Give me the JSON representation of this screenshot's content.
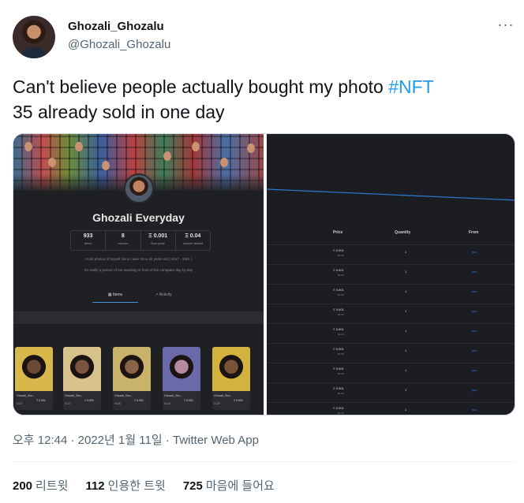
{
  "author": {
    "display_name": "Ghozali_Ghozalu",
    "handle": "@Ghozali_Ghozalu"
  },
  "tweet": {
    "text_before": "Can't believe people actually bought my photo ",
    "hashtag": "#NFT",
    "text_line2": "35 already sold in one day"
  },
  "media": {
    "collection": {
      "name": "Ghozali Everyday",
      "stats": [
        {
          "value": "933",
          "label": "items"
        },
        {
          "value": "8",
          "label": "owners"
        },
        {
          "value": "Ξ 0.001",
          "label": "floor price"
        },
        {
          "value": "Ξ 0.04",
          "label": "volume traded"
        }
      ],
      "description_1": "I took photos of myself since I was 18 to 22 years old ( 2017 - 2021 )",
      "description_2": "It's really a picture of me standing in front of the computer day by day",
      "tabs": {
        "items": "Items",
        "activity": "Activity"
      },
      "cards": [
        {
          "name": "Ghozali_Gho...",
          "num": "#137",
          "price": "Ξ 0.001"
        },
        {
          "name": "Ghozali_Gho...",
          "num": "#137",
          "price": "Ξ 0.001"
        },
        {
          "name": "Ghozali_Gho...",
          "num": "#126",
          "price": "Ξ 0.001"
        },
        {
          "name": "Ghozali_Gho...",
          "num": "#128",
          "price": "Ξ 0.001"
        },
        {
          "name": "Ghozali_Gho...",
          "num": "#130",
          "price": "Ξ 0.001"
        }
      ]
    },
    "listings": {
      "headers": {
        "price": "Price",
        "quantity": "Quantity",
        "from": "From"
      },
      "rows": [
        {
          "price": "Ξ 0.001",
          "usd": "$3.30",
          "quantity": "1",
          "from": "you"
        },
        {
          "price": "Ξ 0.001",
          "usd": "$3.30",
          "quantity": "1",
          "from": "you"
        },
        {
          "price": "Ξ 0.001",
          "usd": "$3.30",
          "quantity": "1",
          "from": "you"
        },
        {
          "price": "Ξ 0.001",
          "usd": "$3.30",
          "quantity": "1",
          "from": "you"
        },
        {
          "price": "Ξ 0.001",
          "usd": "$3.30",
          "quantity": "1",
          "from": "you"
        },
        {
          "price": "Ξ 0.001",
          "usd": "$3.30",
          "quantity": "1",
          "from": "you"
        },
        {
          "price": "Ξ 0.001",
          "usd": "$3.30",
          "quantity": "1",
          "from": "you"
        },
        {
          "price": "Ξ 0.001",
          "usd": "$3.30",
          "quantity": "1",
          "from": "you"
        },
        {
          "price": "Ξ 0.001",
          "usd": "$3.30",
          "quantity": "1",
          "from": "you"
        }
      ]
    }
  },
  "meta": {
    "timestamp": "오후 12:44 · 2022년 1월 11일 · Twitter Web App"
  },
  "counts": {
    "retweets_num": "200",
    "retweets_label": "리트윗",
    "quotes_num": "112",
    "quotes_label": "인용한 트윗",
    "likes_num": "725",
    "likes_label": "마음에 들어요"
  },
  "icons": {
    "more": "more-horizontal-icon",
    "grid": "grid-icon",
    "activity": "activity-icon"
  },
  "colors": {
    "accent": "#1d9bf0",
    "text": "#0f1419",
    "secondary": "#536471"
  }
}
